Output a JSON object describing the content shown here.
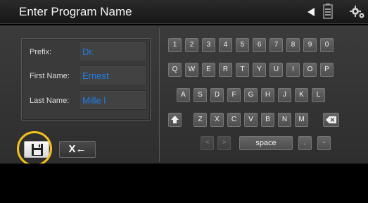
{
  "header": {
    "title": "Enter Program Name",
    "icons": [
      "back-triangle-icon",
      "battery-icon",
      "gears-icon"
    ]
  },
  "form": {
    "prefix_label": "Prefix:",
    "prefix_value": "Dr.",
    "first_label": "First Name:",
    "first_value": "Ernest",
    "last_label": "Last Name:",
    "last_value": "Mille l"
  },
  "actions": {
    "save_icon": "floppy-disk-icon",
    "clear_label": "X←"
  },
  "keyboard": {
    "row1": [
      "1",
      "2",
      "3",
      "4",
      "5",
      "6",
      "7",
      "8",
      "9",
      "0"
    ],
    "row2": [
      "Q",
      "W",
      "E",
      "R",
      "T",
      "Y",
      "U",
      "I",
      "O",
      "P"
    ],
    "row3": [
      "A",
      "S",
      "D",
      "F",
      "G",
      "H",
      "J",
      "K",
      "L"
    ],
    "row4": [
      "Z",
      "X",
      "C",
      "V",
      "B",
      "N",
      "M"
    ],
    "space_label": "space",
    "period_label": ".",
    "dash_label": "-",
    "left_label": "<",
    "right_label": ">"
  },
  "colors": {
    "field_text": "#1e7fe6",
    "highlight": "#f4c01c"
  }
}
